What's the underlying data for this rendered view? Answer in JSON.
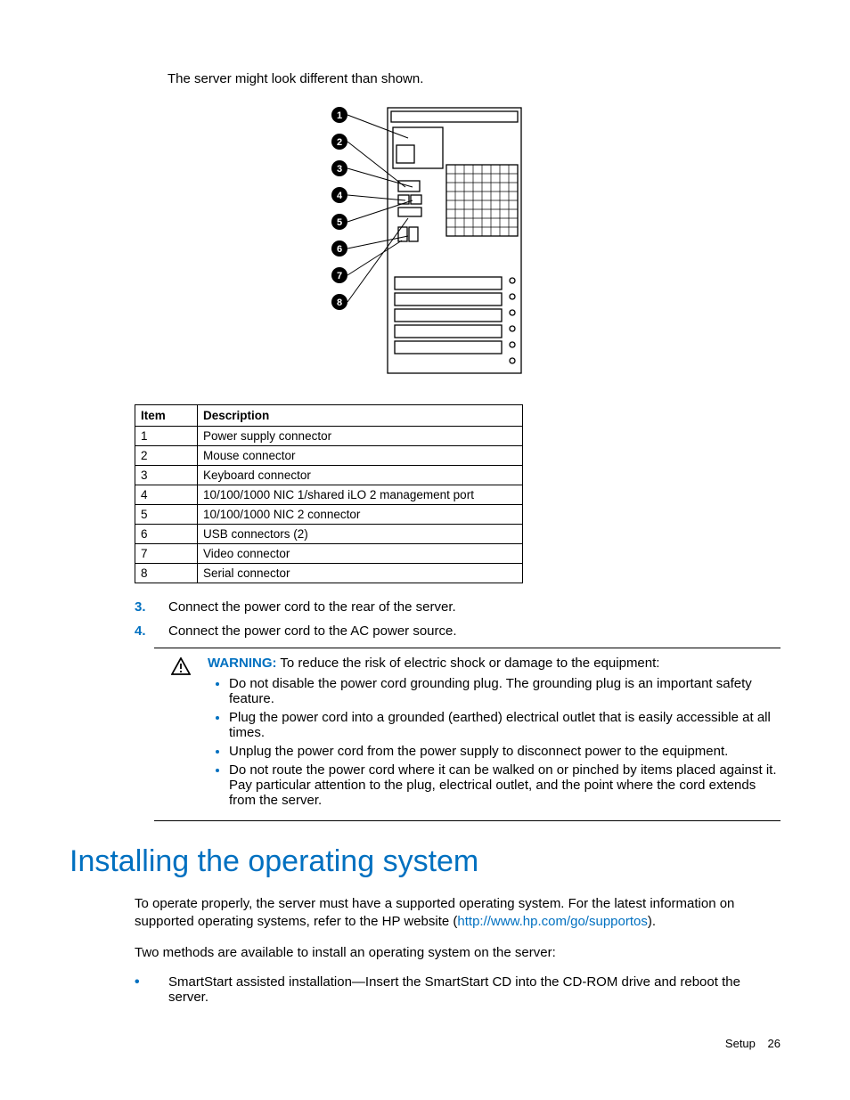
{
  "intro": "The server might look different than shown.",
  "table": {
    "headers": {
      "item": "Item",
      "desc": "Description"
    },
    "rows": [
      {
        "item": "1",
        "desc": "Power supply connector"
      },
      {
        "item": "2",
        "desc": "Mouse connector"
      },
      {
        "item": "3",
        "desc": "Keyboard connector"
      },
      {
        "item": "4",
        "desc": "10/100/1000 NIC 1/shared iLO 2 management port"
      },
      {
        "item": "5",
        "desc": "10/100/1000 NIC 2 connector"
      },
      {
        "item": "6",
        "desc": "USB connectors (2)"
      },
      {
        "item": "7",
        "desc": "Video connector"
      },
      {
        "item": "8",
        "desc": "Serial connector"
      }
    ]
  },
  "steps": [
    {
      "num": "3.",
      "text": "Connect the power cord to the rear of the server."
    },
    {
      "num": "4.",
      "text": "Connect the power cord to the AC power source."
    }
  ],
  "warning": {
    "label": "WARNING:",
    "lead": "  To reduce the risk of electric shock or damage to the equipment:",
    "items": [
      "Do not disable the power cord grounding plug. The grounding plug is an important safety feature.",
      "Plug the power cord into a grounded (earthed) electrical outlet that is easily accessible at all times.",
      "Unplug the power cord from the power supply to disconnect power to the equipment.",
      "Do not route the power cord where it can be walked on or pinched by items placed against it. Pay particular attention to the plug, electrical outlet, and the point where the cord extends from the server."
    ]
  },
  "section_heading": "Installing the operating system",
  "para1_a": "To operate properly, the server must have a supported operating system. For the latest information on supported operating systems, refer to the HP website (",
  "para1_link": "http://www.hp.com/go/supportos",
  "para1_b": ").",
  "para2": "Two methods are available to install an operating system on the server:",
  "method1": "SmartStart assisted installation—Insert the SmartStart CD into the CD-ROM drive and reboot the server.",
  "footer": {
    "section": "Setup",
    "page": "26"
  },
  "diagram_callouts": [
    "1",
    "2",
    "3",
    "4",
    "5",
    "6",
    "7",
    "8"
  ]
}
